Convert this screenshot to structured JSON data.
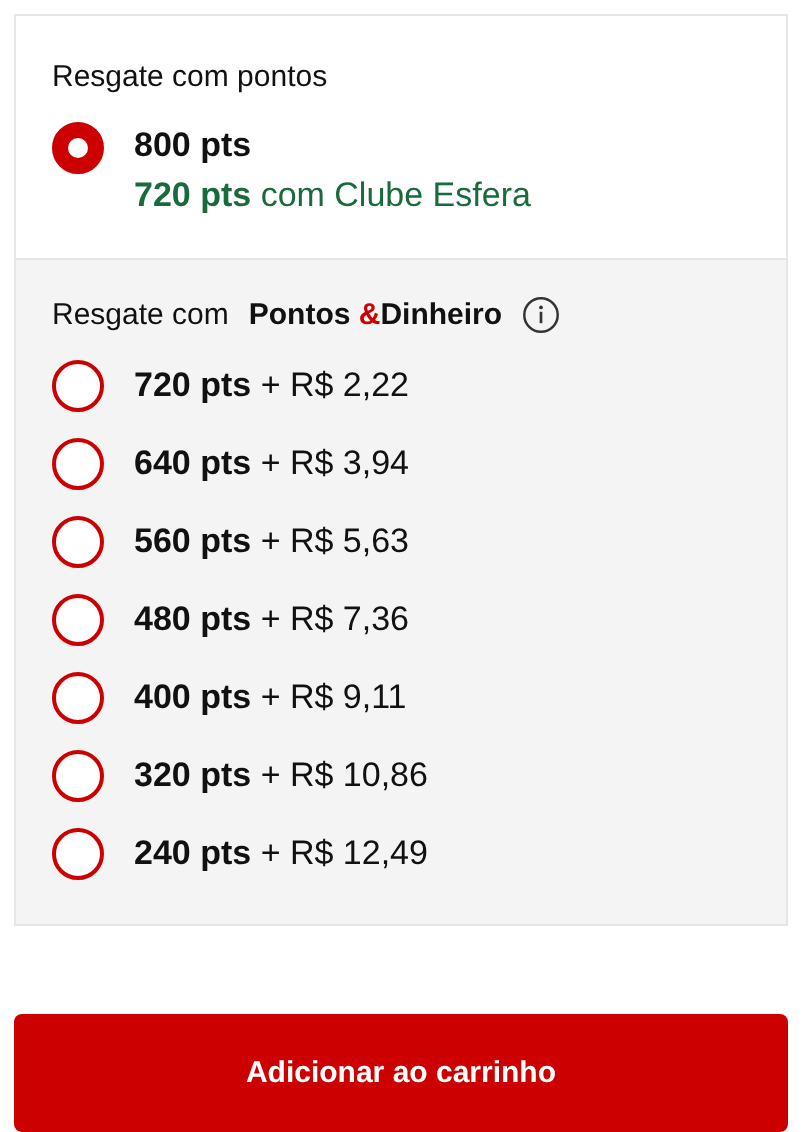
{
  "points_section": {
    "heading": "Resgate com pontos",
    "option": {
      "label": "**800 pts**",
      "club_line": "**720 pts** com Clube Esfera",
      "selected": true
    }
  },
  "mixed_section": {
    "heading": "Resgate com",
    "brand_1": "Pontos ",
    "brand_sep": "&",
    "brand_2": "Dinheiro",
    "options": [
      {
        "label": "**720 pts** + R$ 2,22",
        "selected": false
      },
      {
        "label": "**640 pts** + R$ 3,94",
        "selected": false
      },
      {
        "label": "**560 pts** + R$ 5,63",
        "selected": false
      },
      {
        "label": "**480 pts** + R$ 7,36",
        "selected": false
      },
      {
        "label": "**400 pts** + R$ 9,11",
        "selected": false
      },
      {
        "label": "**320 pts** + R$ 10,86",
        "selected": false
      },
      {
        "label": "**240 pts** + R$ 12,49",
        "selected": false
      }
    ]
  },
  "add_button": "Adicionar ao carrinho"
}
